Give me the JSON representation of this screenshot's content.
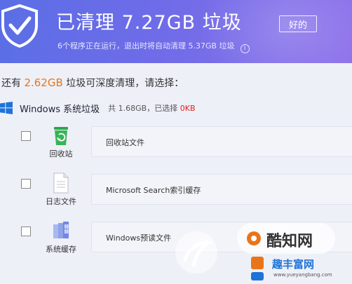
{
  "header": {
    "title": "已清理 7.27GB 垃圾",
    "subtitle": "6个程序正在运行，退出时将自动清理 5.37GB 垃圾",
    "info_glyph": "i",
    "ok_label": "好的",
    "icons": {
      "logo": "shield-check-icon",
      "info": "info-icon"
    }
  },
  "prompt": {
    "prefix": "还有 ",
    "amount": "2.62GB",
    "suffix": " 垃圾可深度清理，请选择："
  },
  "section": {
    "title": "Windows 系统垃圾",
    "total": "共 1.68GB，已选择 ",
    "selected": "0KB",
    "icon": "windows-logo-icon"
  },
  "items": [
    {
      "category": "回收站",
      "file_label": "回收站文件",
      "icon": "recycle-bin-icon",
      "checked": false
    },
    {
      "category": "日志文件",
      "file_label": "Microsoft Search索引缓存",
      "icon": "document-icon",
      "checked": false
    },
    {
      "category": "系统缓存",
      "file_label": "Windows预读文件",
      "icon": "windows-cache-icon",
      "checked": false
    }
  ],
  "watermark": {
    "text1": "酷知网",
    "text2": "趣丰富网",
    "url": "www.yueyangbang.com"
  },
  "colors": {
    "header_start": "#5a6ee6",
    "header_end": "#8c6fea",
    "highlight": "#e8751a",
    "selected_red": "#e02020",
    "recycle_green": "#2aa84a"
  }
}
